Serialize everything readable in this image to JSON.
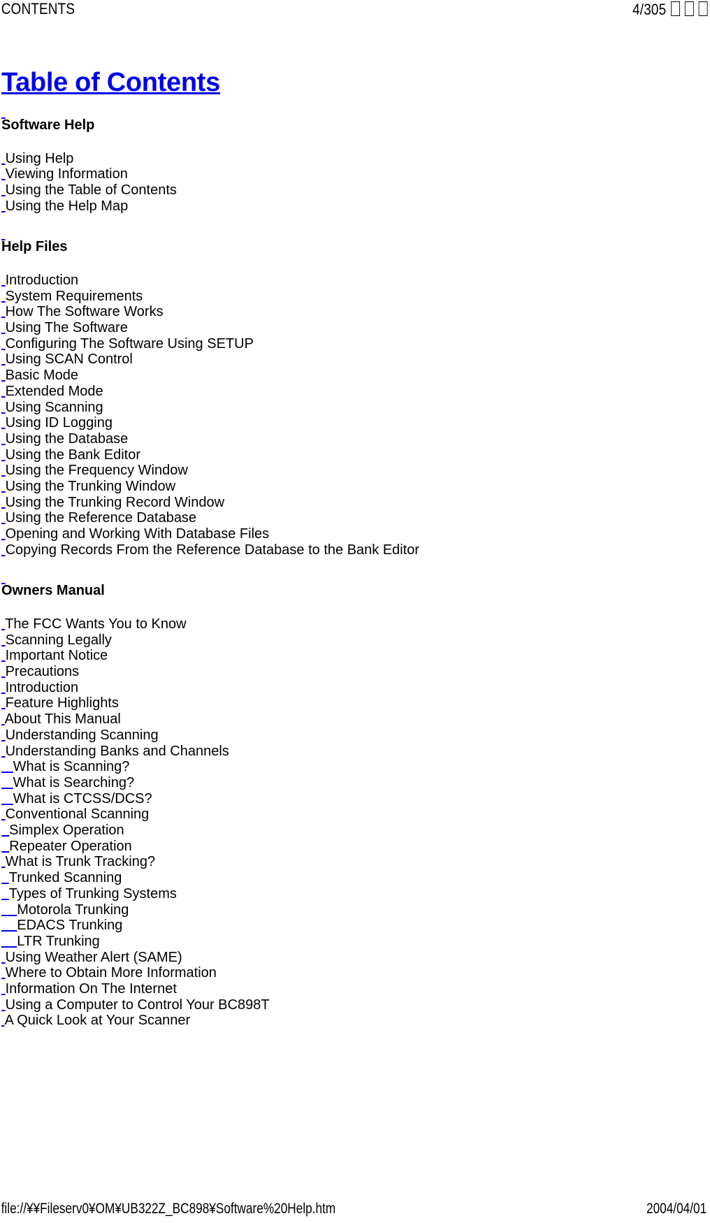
{
  "print_header": {
    "left_label": "CONTENTS",
    "page_indicator": "4/305",
    "tofu_count": 3
  },
  "print_footer": {
    "file_path": "file://¥¥Fileserv0¥OM¥UB322Z_BC898¥Software%20Help.htm",
    "date": "2004/04/01"
  },
  "colors": {
    "link": "#0000ee",
    "text": "#000000",
    "background": "#ffffff"
  },
  "document": {
    "title": "Table of Contents",
    "sections": [
      {
        "heading": "Software Help",
        "items": [
          {
            "label": "Using Help",
            "indent": 0
          },
          {
            "label": "Viewing Information",
            "indent": 0
          },
          {
            "label": "Using the Table of Contents",
            "indent": 0
          },
          {
            "label": "Using the Help Map",
            "indent": 0
          }
        ]
      },
      {
        "heading": "Help Files",
        "items": [
          {
            "label": "Introduction",
            "indent": 0
          },
          {
            "label": "System Requirements",
            "indent": 0
          },
          {
            "label": "How The Software Works",
            "indent": 0
          },
          {
            "label": "Using The Software",
            "indent": 0
          },
          {
            "label": "Configuring The Software Using SETUP",
            "indent": 0
          },
          {
            "label": "Using SCAN Control",
            "indent": 0
          },
          {
            "label": "Basic Mode",
            "indent": 0
          },
          {
            "label": "Extended Mode",
            "indent": 0
          },
          {
            "label": "Using Scanning",
            "indent": 0
          },
          {
            "label": "Using ID Logging",
            "indent": 0
          },
          {
            "label": "Using the Database",
            "indent": 0
          },
          {
            "label": "Using the Bank Editor",
            "indent": 0
          },
          {
            "label": "Using the Frequency Window",
            "indent": 0
          },
          {
            "label": "Using the Trunking Window",
            "indent": 0
          },
          {
            "label": "Using the Trunking Record Window",
            "indent": 0
          },
          {
            "label": "Using the Reference Database",
            "indent": 0
          },
          {
            "label": "Opening and Working With Database Files",
            "indent": 0
          },
          {
            "label": "Copying Records From the Reference Database to the Bank Editor",
            "indent": 0
          }
        ]
      },
      {
        "heading": "Owners Manual",
        "items": [
          {
            "label": "The FCC Wants You to Know",
            "indent": 0
          },
          {
            "label": "Scanning Legally",
            "indent": 0
          },
          {
            "label": "Important Notice",
            "indent": 0
          },
          {
            "label": "Precautions",
            "indent": 0
          },
          {
            "label": "Introduction",
            "indent": 0
          },
          {
            "label": "Feature Highlights",
            "indent": 0
          },
          {
            "label": "About This Manual",
            "indent": 0
          },
          {
            "label": "Understanding Scanning",
            "indent": 0
          },
          {
            "label": "Understanding Banks and Channels",
            "indent": 0
          },
          {
            "label": "What is Scanning?",
            "indent": 2
          },
          {
            "label": "What is Searching?",
            "indent": 2
          },
          {
            "label": "What is CTCSS/DCS?",
            "indent": 2
          },
          {
            "label": "Conventional Scanning",
            "indent": 0
          },
          {
            "label": "Simplex Operation",
            "indent": 1
          },
          {
            "label": "Repeater Operation",
            "indent": 1
          },
          {
            "label": "What is Trunk Tracking?",
            "indent": -1
          },
          {
            "label": "Trunked Scanning",
            "indent": 1
          },
          {
            "label": "Types of Trunking Systems",
            "indent": 1
          },
          {
            "label": "Motorola Trunking",
            "indent": 3
          },
          {
            "label": "EDACS Trunking",
            "indent": 3
          },
          {
            "label": "LTR Trunking",
            "indent": 3
          },
          {
            "label": "Using Weather Alert (SAME)",
            "indent": 0
          },
          {
            "label": "Where to Obtain More Information",
            "indent": 0
          },
          {
            "label": "Information On The Internet",
            "indent": 0
          },
          {
            "label": "Using a Computer to Control Your BC898T",
            "indent": 0
          },
          {
            "label": "A Quick Look at Your Scanner",
            "indent": 0
          }
        ]
      }
    ]
  }
}
